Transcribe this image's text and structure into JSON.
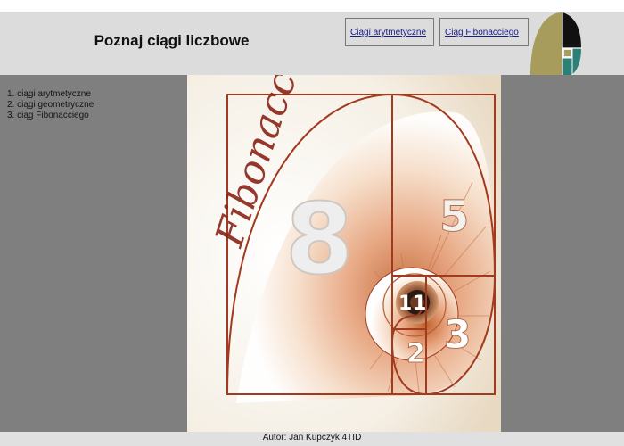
{
  "header": {
    "title": "Poznaj ciągi liczbowe",
    "nav": [
      "Ciągi arytmetyczne",
      "Ciąg Fibonacciego"
    ]
  },
  "sidebar": {
    "items": [
      "1. ciągi arytmetyczne",
      "2. ciągi geometryczne",
      "3. ciąg Fibonacciego"
    ]
  },
  "image": {
    "script_word": "Fibonacci",
    "numbers": [
      "8",
      "5",
      "3",
      "2",
      "1",
      "1"
    ]
  },
  "footer": {
    "text": "Autor: Jan Kupczyk 4TID"
  },
  "colors": {
    "header_bg": "#dcdcdc",
    "side_bg": "#7f7f7f",
    "link": "#1a1a8c",
    "spiral": "#a23a20",
    "logo_gold": "#a89c5c",
    "logo_teal": "#2e7f77"
  }
}
